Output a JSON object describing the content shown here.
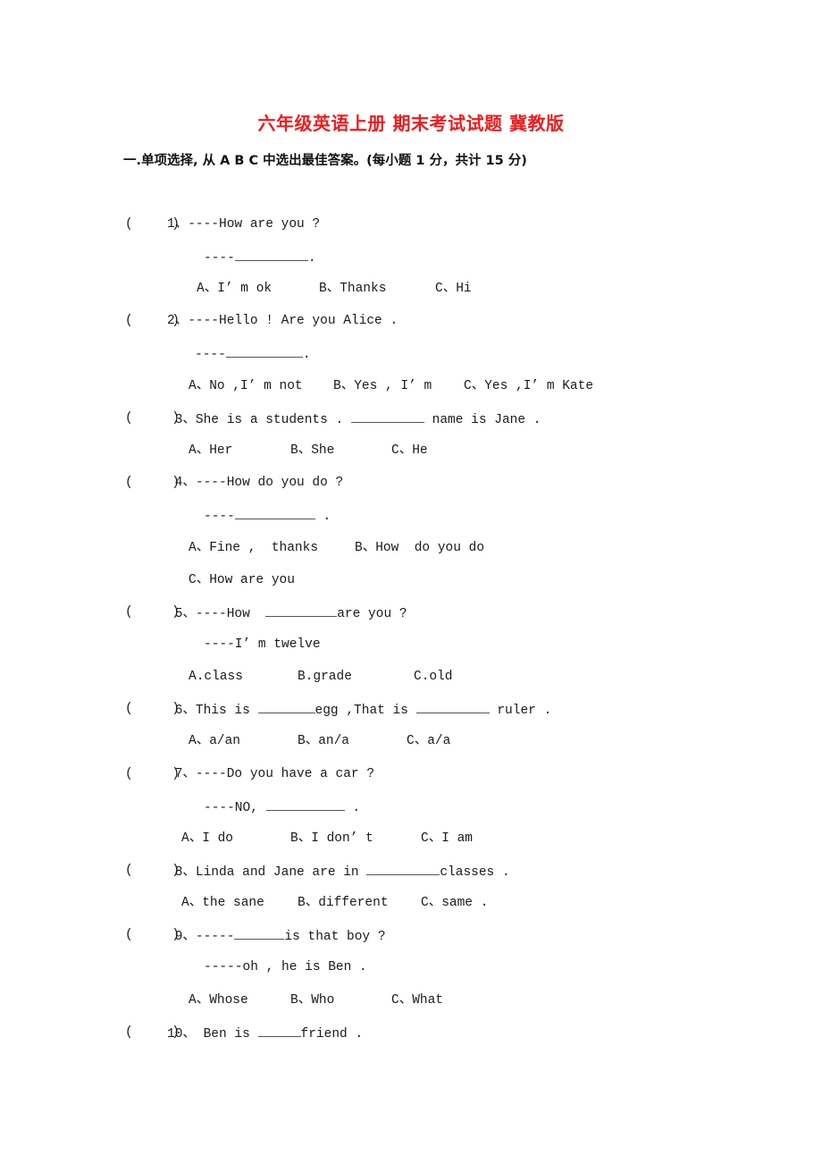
{
  "title": "六年级英语上册 期末考试试题 冀教版",
  "section": {
    "heading": "一.单项选择, 从 A B C 中选出最佳答案。(每小题 1 分，共计 15 分)"
  },
  "answer_paren": "(     )",
  "questions": [
    {
      "number": "1、",
      "prompt": "----How are you ?",
      "response_prefix": "----",
      "response_suffix": ".",
      "options": [
        "A、I’ m ok",
        "B、Thanks",
        "C、Hi"
      ]
    },
    {
      "number": "2、",
      "prompt": "----Hello ! Are you Alice .",
      "response_prefix": "----",
      "response_suffix": ".",
      "options": [
        "A、No ,I’ m not",
        "B、Yes , I’ m",
        "C、Yes ,I’ m Kate"
      ]
    },
    {
      "number": "3、",
      "prompt_before": "She is a students . ",
      "prompt_after": " name is Jane .",
      "options": [
        "A、Her",
        "B、She",
        "C、He"
      ]
    },
    {
      "number": "4、",
      "prompt": "----How do you do ?",
      "response_prefix": "----",
      "response_suffix": " .",
      "options": [
        "A、Fine ,  thanks",
        "B、How  do you do",
        "C、How are you"
      ]
    },
    {
      "number": "5、",
      "prompt_before": "----How  ",
      "prompt_after": "are you ?",
      "response": "----I’ m twelve",
      "options": [
        "A.class",
        "B.grade",
        "C.old"
      ]
    },
    {
      "number": "6、",
      "prompt_before": "This is ",
      "prompt_middle": "egg ,That is ",
      "prompt_after": " ruler .",
      "options": [
        "A、a/an",
        "B、an/a",
        "C、a/a"
      ]
    },
    {
      "number": "7、",
      "prompt": "----Do you have a car ?",
      "response_prefix": "----NO, ",
      "response_suffix": " .",
      "options": [
        "A、I do",
        "B、I don’ t",
        "C、I am"
      ]
    },
    {
      "number": "8、",
      "prompt_before": "Linda and Jane are in ",
      "prompt_after": "classes .",
      "options": [
        "A、the sane",
        "B、different",
        "C、same ."
      ]
    },
    {
      "number": "9、",
      "prompt_before": "-----",
      "prompt_after": "is that boy ?",
      "response": "-----oh , he is Ben .",
      "options": [
        "A、Whose",
        "B、Who",
        "C、What"
      ]
    },
    {
      "number": "10、",
      "prompt_before": " Ben is ",
      "prompt_after": "friend ."
    }
  ]
}
